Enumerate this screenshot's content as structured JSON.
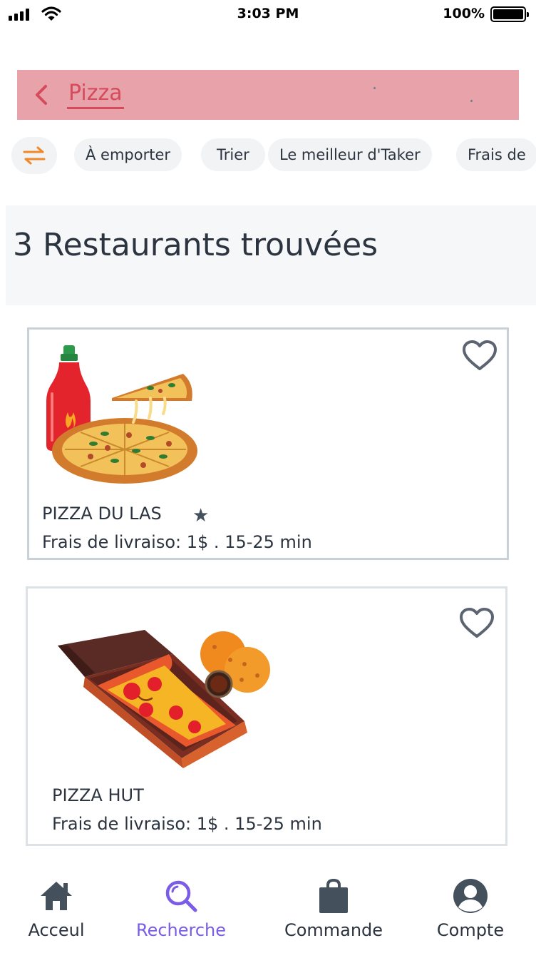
{
  "status_bar": {
    "time": "3:03 PM",
    "battery_percent": "100%",
    "battery_level": 1.0
  },
  "search": {
    "back_icon": "chevron-left-icon",
    "query": "Pizza"
  },
  "filters": {
    "toggle_icon": "swap-arrows-icon",
    "chips": [
      "À emporter",
      "Trier",
      "Le meilleur d'Taker",
      "Frais de"
    ]
  },
  "results": {
    "title": "3 Restaurants trouvées"
  },
  "restaurants": [
    {
      "name": "PIZZA DU LAS",
      "rating_icon": "star-icon",
      "meta": "Frais de livraiso:  1$ .  15-25 min",
      "image": "pizza-with-hot-sauce-image",
      "favorite_icon": "heart-outline-icon"
    },
    {
      "name": "PIZZA HUT",
      "meta": "Frais de livraiso:  1$ .  15-25 min",
      "image": "pizza-box-with-nuggets-image",
      "favorite_icon": "heart-outline-icon"
    }
  ],
  "nav": {
    "items": [
      {
        "label": "Acceul",
        "icon": "home-icon"
      },
      {
        "label": "Recherche",
        "icon": "search-icon"
      },
      {
        "label": "Commande",
        "icon": "shopping-bag-icon"
      },
      {
        "label": "Compte",
        "icon": "account-icon"
      }
    ],
    "active": "Recherche"
  },
  "colors": {
    "accent": "#7a5ce6",
    "search_bar_bg": "#e8a2aa",
    "search_text": "#d64b5c",
    "filter_icon": "#f0892a"
  }
}
